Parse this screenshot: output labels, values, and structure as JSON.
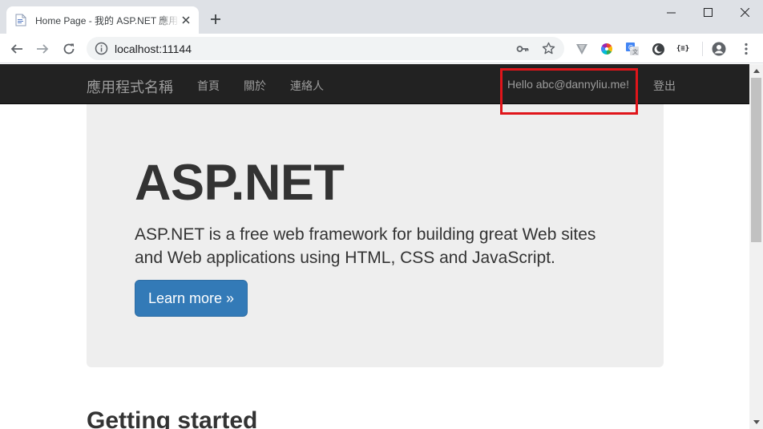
{
  "browser": {
    "tab": {
      "title": "Home Page - 我的 ASP.NET 應用程式"
    },
    "url": "localhost:11144",
    "icons": [
      "favicon-icon",
      "close-icon",
      "plus-icon",
      "minimize-icon",
      "maximize-icon",
      "window-close-icon",
      "back-icon",
      "forward-icon",
      "reload-icon",
      "info-icon",
      "key-icon",
      "star-icon",
      "vimium-icon",
      "color-picker-icon",
      "translate-icon",
      "dark-mode-icon",
      "json-formatter-icon",
      "account-icon",
      "menu-icon"
    ],
    "json_ext_label": "{≡}"
  },
  "navbar": {
    "brand": "應用程式名稱",
    "links": [
      {
        "label": "首頁"
      },
      {
        "label": "關於"
      },
      {
        "label": "連絡人"
      }
    ],
    "hello": "Hello abc@dannyliu.me!",
    "logout": "登出",
    "highlight_color": "#e0151a"
  },
  "jumbotron": {
    "title": "ASP.NET",
    "lead": "ASP.NET is a free web framework for building great Web sites and Web applications using HTML, CSS and JavaScript.",
    "button": "Learn more »"
  },
  "section": {
    "heading": "Getting started"
  },
  "colors": {
    "navbar_bg": "#222222",
    "nav_text": "#9d9d9d",
    "jumbotron_bg": "#eeeeee",
    "button_primary": "#337ab7"
  }
}
